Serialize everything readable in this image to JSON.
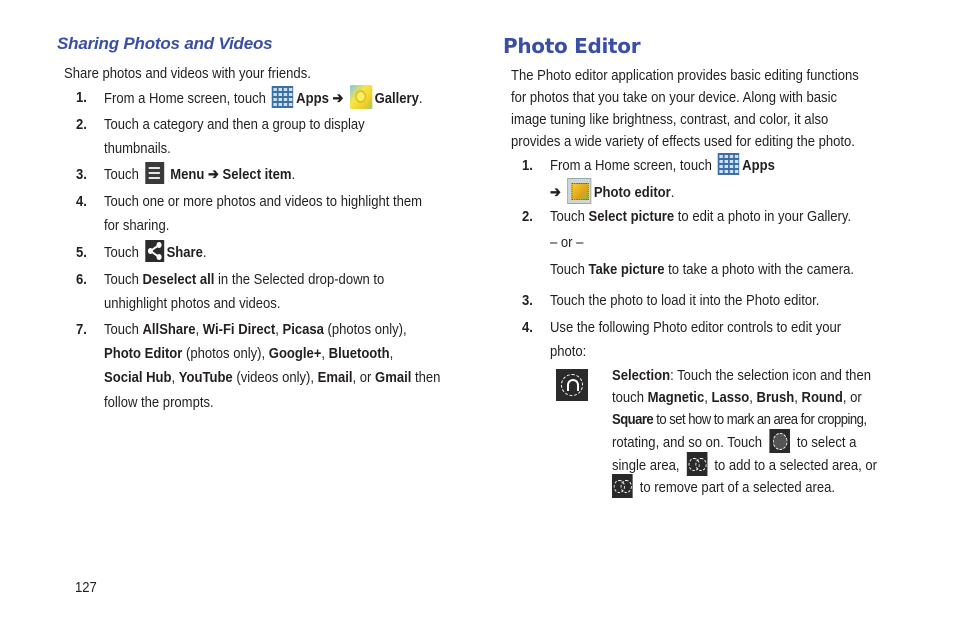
{
  "left": {
    "heading": "Sharing Photos and Videos",
    "intro": "Share photos and videos with your friends.",
    "steps": [
      {
        "num": "1.",
        "pre": "From a Home screen, touch",
        "apps": "Apps",
        "arrow": "➔",
        "gallery": "Gallery",
        "end": "."
      },
      {
        "num": "2.",
        "l1": "Touch a category and then a group to display",
        "l2": "thumbnails."
      },
      {
        "num": "3.",
        "pre": "Touch",
        "menu": "Menu",
        "arrow": "➔",
        "select_item": "Select item",
        "end": "."
      },
      {
        "num": "4.",
        "l1": "Touch one or more photos and videos to highlight them",
        "l2": "for sharing."
      },
      {
        "num": "5.",
        "pre": "Touch",
        "share": "Share",
        "end": "."
      },
      {
        "num": "6.",
        "pre": "Touch",
        "deselect": "Deselect all",
        "post": "in the Selected drop-down to",
        "l2": "unhighlight photos and videos."
      },
      {
        "num": "7.",
        "pre": "Touch",
        "allshare": "AllShare",
        "wifi": "Wi-Fi Direct",
        "picasa": "Picasa",
        "photos_only": "(photos only),",
        "photo_editor": "Photo Editor",
        "photos_only2": "(photos only),",
        "google": "Google+",
        "bluetooth": "Bluetooth",
        "social_hub": "Social Hub",
        "youtube": "YouTube",
        "videos_only": "(videos only),",
        "email": "Email",
        "or": ", or",
        "gmail": "Gmail",
        "then": "then",
        "l4": "follow the prompts."
      }
    ]
  },
  "right": {
    "heading": "Photo Editor",
    "intro_lines": [
      "The Photo editor application provides basic editing functions",
      "for photos that you take on your device. Along with basic",
      "image tuning like brightness, contrast, and color, it also",
      "provides a wide variety of effects used for editing the photo."
    ],
    "steps": [
      {
        "num": "1.",
        "pre": "From a Home screen, touch",
        "apps": "Apps",
        "arrow": "➔",
        "photo_editor": "Photo editor",
        "end": "."
      },
      {
        "num": "2.",
        "pre": "Touch",
        "select_picture": "Select picture",
        "post": "to edit a photo in your Gallery.",
        "or": "– or –",
        "pre2": "Touch",
        "take_picture": "Take picture",
        "post2": "to take a photo with the camera."
      },
      {
        "num": "3.",
        "l1": "Touch the photo to load it into the Photo editor."
      },
      {
        "num": "4.",
        "l1": "Use the following Photo editor controls to edit your",
        "l2": "photo:"
      }
    ],
    "selection": {
      "title": "Selection",
      "l1_rest": ": Touch the selection icon and then",
      "touch": "touch",
      "magnetic": "Magnetic",
      "lasso": "Lasso",
      "brush": "Brush",
      "round": "Round",
      "or": ", or",
      "square": "Square",
      "l3_rest": "to set how to mark an area for cropping,",
      "l4_pre": "rotating, and so on. Touch",
      "l4_post": "to select a",
      "l5_pre": "single area,",
      "l5_post": "to add to a selected area, or",
      "l6_post": "to remove part of a selected area."
    }
  },
  "footer": {
    "page_number": "127"
  }
}
